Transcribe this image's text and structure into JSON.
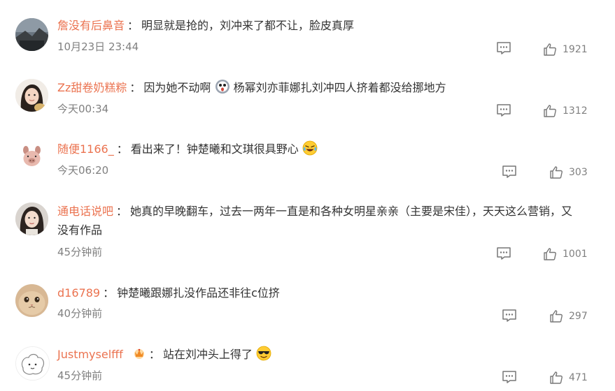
{
  "comments": [
    {
      "username": "詹没有后鼻音",
      "colon": "：",
      "content": "明显就是抢的，刘冲来了都不让，脸皮真厚",
      "time": "10月23日 23:44",
      "likes": "1921",
      "avatar": "landscape-avatar"
    },
    {
      "username": "Zz甜卷奶糕粽",
      "colon": "：",
      "content_a": "因为她不动啊",
      "emoji": "shocked-face-emoji",
      "content_b": "杨幂刘亦菲娜扎刘冲四人挤着都没给挪地方",
      "time": "今天00:34",
      "likes": "1312",
      "avatar": "girl-avatar"
    },
    {
      "username": "随便1166_",
      "colon": "：",
      "content": "看出来了！钟楚曦和文琪很具野心",
      "emoji": "laughing-crying-emoji",
      "time": "今天06:20",
      "likes": "303",
      "avatar": "pig-avatar"
    },
    {
      "username": "通电话说吧",
      "colon": "：",
      "content_line1": "她真的早晚翻车，过去一两年一直是和各种女明星亲亲（主要是宋佳），天天这么营销，又",
      "content_line2": "没有作品",
      "time": "45分钟前",
      "likes": "1001",
      "avatar": "woman-avatar"
    },
    {
      "username": "d16789",
      "colon": "：",
      "content": "钟楚曦跟娜扎没作品还非往c位挤",
      "time": "40分钟前",
      "likes": "297",
      "avatar": "cat-avatar"
    },
    {
      "username": "Justmyselfff",
      "colon": "：",
      "content": "站在刘冲头上得了",
      "badge": "crown-badge-icon",
      "emoji": "sunglasses-emoji",
      "time": "45分钟前",
      "likes": "471",
      "avatar": "cartoon-avatar"
    }
  ]
}
